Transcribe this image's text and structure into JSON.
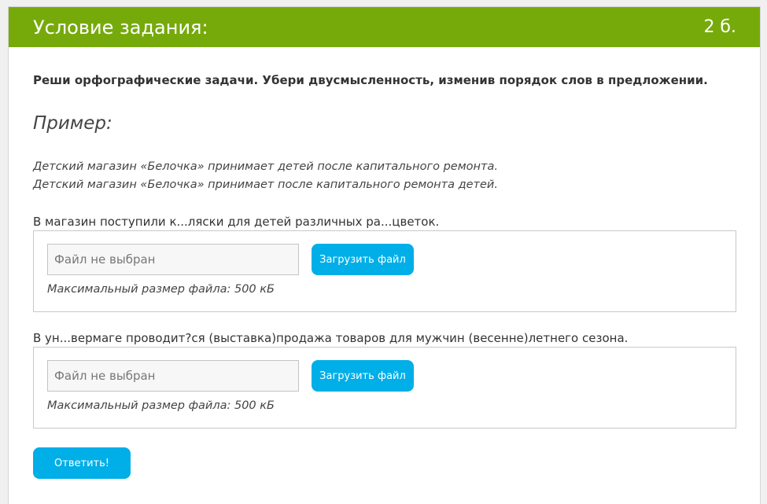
{
  "header": {
    "title": "Условие задания:",
    "score": "2 б."
  },
  "instruction": "Реши орфографические задачи. Убери двусмысленность, изменив порядок слов в предложении.",
  "example": {
    "heading": "Пример:",
    "lines": [
      "Детский магазин «Белочка» принимает детей после капитального ремонта.",
      "Детский магазин «Белочка» принимает после капитального ремонта детей."
    ]
  },
  "tasks": [
    {
      "text": "В магазин поступили к...ляски для детей различных ра...цветок.",
      "file_placeholder": "Файл не выбран",
      "upload_label": "Загрузить файл",
      "max_size": "Максимальный размер файла: 500 кБ"
    },
    {
      "text": "В ун...вермаге проводит?ся (выставка)продажа товаров для мужчин (весенне)летнего сезона.",
      "file_placeholder": "Файл не выбран",
      "upload_label": "Загрузить файл",
      "max_size": "Максимальный размер файла: 500 кБ"
    }
  ],
  "answer_label": "Ответить!",
  "colors": {
    "header_bg": "#76aa0b",
    "button_bg": "#00aee8"
  }
}
